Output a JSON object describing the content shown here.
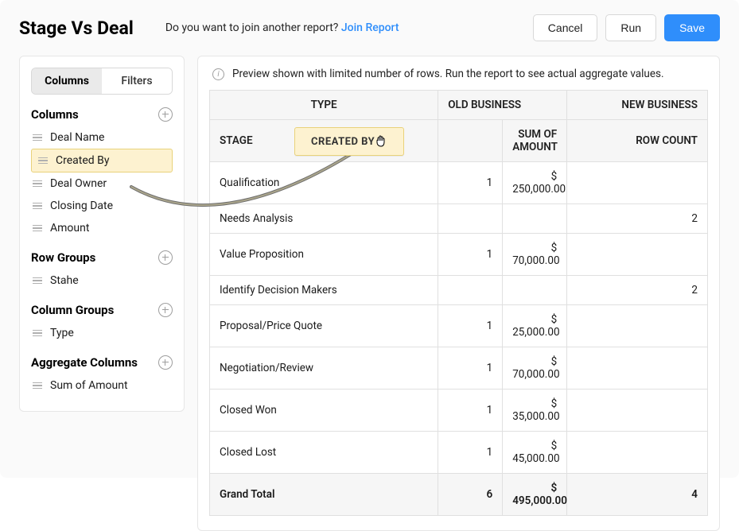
{
  "header": {
    "title": "Stage Vs Deal",
    "subtitle_text": "Do you want to join another report? ",
    "join_link": "Join Report",
    "cancel": "Cancel",
    "run": "Run",
    "save": "Save"
  },
  "sidebar": {
    "tabs": {
      "columns": "Columns",
      "filters": "Filters"
    },
    "sections": {
      "columns": {
        "title": "Columns",
        "items": [
          "Deal Name",
          "Created By",
          "Deal Owner",
          "Closing Date",
          "Amount"
        ]
      },
      "row_groups": {
        "title": "Row Groups",
        "items": [
          "Stahe"
        ]
      },
      "column_groups": {
        "title": "Column Groups",
        "items": [
          "Type"
        ]
      },
      "aggregate_columns": {
        "title": "Aggregate Columns",
        "items": [
          "Sum of Amount"
        ]
      }
    }
  },
  "preview": {
    "notice": "Preview shown with limited number of rows. Run the report to see actual aggregate values.",
    "headers": {
      "type": "TYPE",
      "stage": "STAGE",
      "old_business": "OLD BUSINESS",
      "new_business": "NEW BUSINESS",
      "sum_of_amount": "SUM OF AMOUNT",
      "row_count": "ROW COUNT"
    },
    "rows": [
      {
        "stage": "Qualification",
        "count": "1",
        "sum": "$ 250,000.00",
        "row_count": ""
      },
      {
        "stage": "Needs Analysis",
        "count": "",
        "sum": "",
        "row_count": "2"
      },
      {
        "stage": "Value Proposition",
        "count": "1",
        "sum": "$ 70,000.00",
        "row_count": ""
      },
      {
        "stage": "Identify Decision Makers",
        "count": "",
        "sum": "",
        "row_count": "2"
      },
      {
        "stage": "Proposal/Price Quote",
        "count": "1",
        "sum": "$ 25,000.00",
        "row_count": ""
      },
      {
        "stage": "Negotiation/Review",
        "count": "1",
        "sum": "$ 70,000.00",
        "row_count": ""
      },
      {
        "stage": "Closed Won",
        "count": "1",
        "sum": "$ 35,000.00",
        "row_count": ""
      },
      {
        "stage": "Closed Lost",
        "count": "1",
        "sum": "$ 45,000.00",
        "row_count": ""
      }
    ],
    "grand_total": {
      "label": "Grand Total",
      "count": "6",
      "sum": "$ 495,000.00",
      "row_count": "4"
    }
  },
  "drag_chip": {
    "label": "CREATED BY"
  }
}
